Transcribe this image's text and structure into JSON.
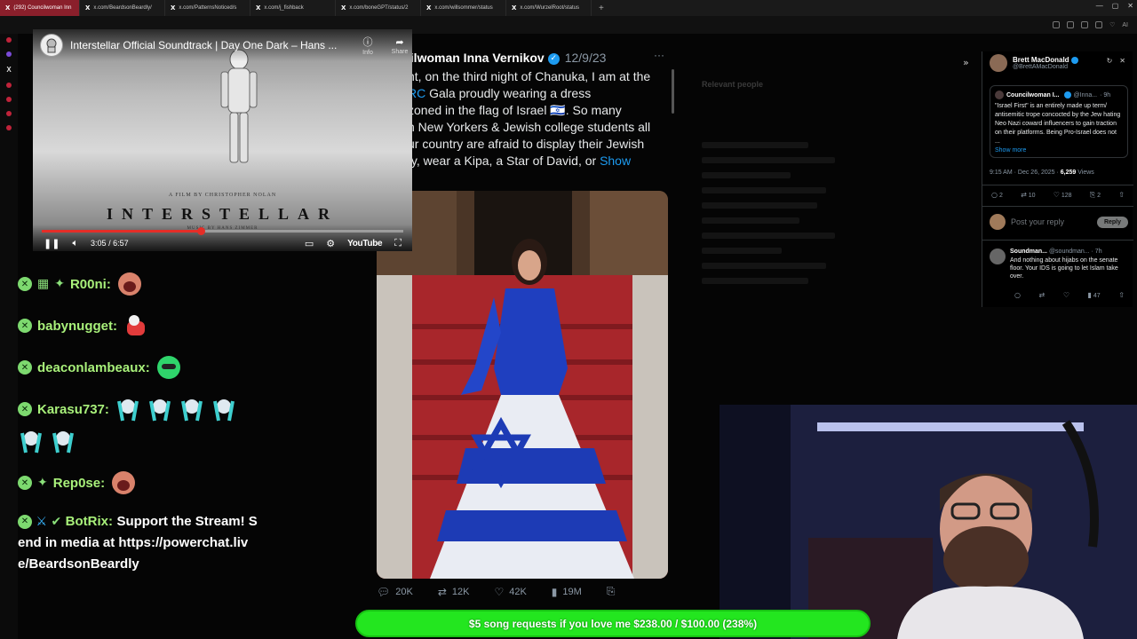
{
  "browser": {
    "tabs": [
      {
        "label": "(292) Councilwoman Inn",
        "active": true
      },
      {
        "label": "x.com/BeardsonBeardly/",
        "active": false
      },
      {
        "label": "x.com/PatternsNoticed/s",
        "active": false
      },
      {
        "label": "x.com/j_fishback",
        "active": false
      },
      {
        "label": "x.com/boneGPT/status/2",
        "active": false
      },
      {
        "label": "x.com/willsommer/status",
        "active": false
      },
      {
        "label": "x.com/WurzelRoot/status",
        "active": false
      }
    ],
    "new_tab": "+",
    "ai_label": "AI"
  },
  "video": {
    "title": "Interstellar Official Soundtrack | Day One Dark – Hans ...",
    "info_label": "Info",
    "share_label": "Share",
    "poster_credit": "A FILM BY CHRISTOPHER NOLAN",
    "poster_title": "INTERSTELLAR",
    "poster_music": "MUSIC BY HANS ZIMMER",
    "time": "3:05 / 6:57",
    "progress": 0.44,
    "youtube_label": "YouTube"
  },
  "chat": {
    "messages": [
      {
        "user": "R00ni:"
      },
      {
        "user": "babynugget:"
      },
      {
        "user": "deaconlambeaux:"
      },
      {
        "user": "Karasu737:"
      },
      {
        "user": "Rep0se:"
      },
      {
        "user": "BotRix:",
        "text": "Support the Stream! Send in media at https://powerchat.live/BeardsonBeardly"
      }
    ]
  },
  "tweet": {
    "name": "cilwoman Inna Vernikov",
    "date": "12/9/23",
    "body_lines": [
      "nt, on the third night of Chanuka, I am at the",
      "RC Gala proudly wearing a dress",
      "zoned in the flag of Israel 🇮🇱. So many",
      "h New Yorkers & Jewish college students all",
      "ur country are afraid to display their Jewish",
      "ty, wear a Kipa, a Star of David, or"
    ],
    "body_link_rc": "RC",
    "show_more": "Show",
    "actions": {
      "replies": "20K",
      "reposts": "12K",
      "likes": "42K",
      "views": "19M"
    }
  },
  "reply_panel": {
    "author_name": "Brett MacDonald",
    "author_handle": "@BrettAMacDonald",
    "quote_name": "Councilwoman I...",
    "quote_handle": "@Inna...",
    "quote_time": "· 9h",
    "quote_text": "\"Israel First\" is an entirely made up term/ antisemitic trope concocted by the Jew hating Neo Nazi coward influencers to gain traction on their platforms. Being Pro-Israel does not ...",
    "quote_more": "Show more",
    "meta_time": "9:15 AM · Dec 26, 2025 ·",
    "meta_views": "6,259",
    "meta_views_label": "Views",
    "stats": {
      "replies": "2",
      "reposts": "10",
      "likes": "128",
      "bookmarks": "2"
    },
    "reply_placeholder": "Post your reply",
    "reply_button": "Reply",
    "comment_name": "Soundman...",
    "comment_handle": "@soundman... · 7h",
    "comment_text": "And nothing about hijabs on the senate floor. Your IDS is going to let Islam take over.",
    "comment_views": "47"
  },
  "ghost": {
    "title": "Relevant people"
  },
  "banner": {
    "text": "$5 song requests if you love me $238.00 / $100.00 (238%)"
  }
}
